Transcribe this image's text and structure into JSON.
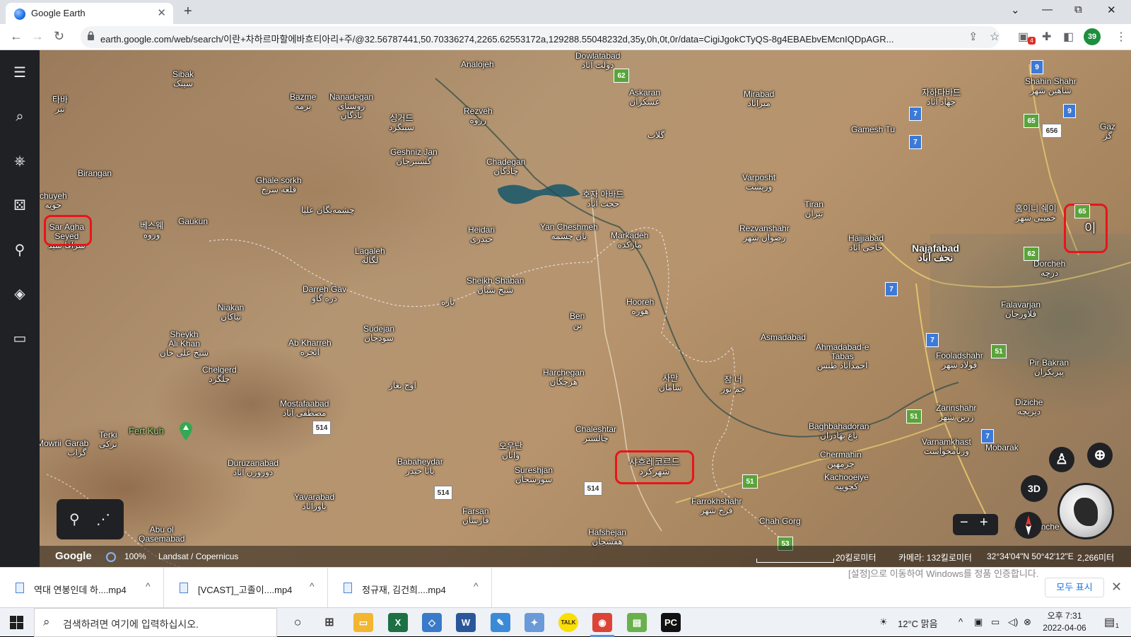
{
  "browser": {
    "tab_title": "Google Earth",
    "tab_close": "✕",
    "new_tab": "+",
    "url": "earth.google.com/web/search/이란+차하르마할에바흐티아리+주/@32.56787441,50.70336274,2265.62553172a,129288.55048232d,35y,0h,0t,0r/data=CigiJgokCTyQS-8g4EBAEbvEMcnIQDpAGR...",
    "profile_badge": "39",
    "extension_count": "4",
    "win_min": "⌄",
    "win_restore": "⧉",
    "win_close": "✕"
  },
  "map": {
    "places": [
      {
        "name": "Dowlatabad\nدولت آباد"
      },
      {
        "name": "Analojeh"
      },
      {
        "name": "Sibak\nسیبک"
      },
      {
        "name": "Bazme\nبزمه"
      },
      {
        "name": "Nanadegan\nروستای\nنادگان"
      },
      {
        "name": "싱거드\nسینگرد"
      },
      {
        "name": "Rezveh\nرزوه"
      },
      {
        "name": "Askaran\nعسکران"
      },
      {
        "name": "Mirabad\nمیرآباد"
      },
      {
        "name": "자하다바드\nجهاد آباد"
      },
      {
        "name": "Shahin Shahr\nشاهین شهر"
      },
      {
        "name": "타바\nتبر"
      },
      {
        "name": "Geshniz Jan\nگشنیزجان"
      },
      {
        "name": "Chadegan\nچادگان"
      },
      {
        "name": "گلاب"
      },
      {
        "name": "Gamesh Tu"
      },
      {
        "name": "Birangan"
      },
      {
        "name": "Ghale sorkh\nقلعه سرخ"
      },
      {
        "name": "Varposht\nورپشت"
      },
      {
        "name": "호자 아바드\nحجت آباد"
      },
      {
        "name": "chuyeh\nحویه"
      },
      {
        "name": "Gaukun"
      },
      {
        "name": "베스웨\nوروه"
      },
      {
        "name": "چشمه‌بگان علیا"
      },
      {
        "name": "Tiran\nتیران"
      },
      {
        "name": "Heidari\nحیدری"
      },
      {
        "name": "Yan Cheshmeh\nیان چشمه"
      },
      {
        "name": "Markadeh\nمارکده"
      },
      {
        "name": "Rezvanshahr\nرضوان شهر"
      },
      {
        "name": "Hajjiabad\nحاجی آباد"
      },
      {
        "name": "Najafabad\nنجف آباد"
      },
      {
        "name": "Lagaleh\nلگاله"
      },
      {
        "name": "Dorcheh\nدرچه"
      },
      {
        "name": "Sheikh Shaban\nشیخ شبان"
      },
      {
        "name": "Darreh Gav\nدره گاو"
      },
      {
        "name": "باره"
      },
      {
        "name": "Hooreh\nهوره"
      },
      {
        "name": "Niakan\nنیاکان"
      },
      {
        "name": "Ben\nبن"
      },
      {
        "name": "Falavarjan\nفلاورجان"
      },
      {
        "name": "Sudejan\nسودجان"
      },
      {
        "name": "Sheykh\nAli Khan\nشیخ علی خان"
      },
      {
        "name": "Ab Kharreh\nابخره"
      },
      {
        "name": "Asmadabad"
      },
      {
        "name": "Ahmadabad-e\nTabas\nاحمدآباد طبس"
      },
      {
        "name": "Fooladshahr\nفولاد شهر"
      },
      {
        "name": "Pir Bakran\nپیربکران"
      },
      {
        "name": "Chelgerd\nچلگرد"
      },
      {
        "name": "Harchegan\nهرچگان"
      },
      {
        "name": "사만\nسامان"
      },
      {
        "name": "잠 너\nجم نور"
      },
      {
        "name": "اوج بغار"
      },
      {
        "name": "Diziche\nدیزیچه"
      },
      {
        "name": "Zarinshahr\nزرین شهر"
      },
      {
        "name": "Mostafaabad\nمصطفی آباد"
      },
      {
        "name": "Fert Kuh"
      },
      {
        "name": "Terki\nترکی"
      },
      {
        "name": "Mowrii"
      },
      {
        "name": "Garab\nگراب"
      },
      {
        "name": "Chaleshtar\nچالشتر"
      },
      {
        "name": "Baghbahadoran\nباغ بهادران"
      },
      {
        "name": "Varnamkhast\nورنامخواست"
      },
      {
        "name": "Mobarak"
      },
      {
        "name": "오우난\nوانان"
      },
      {
        "name": "Chermahin\nچرمهین"
      },
      {
        "name": "Duruzanabad\nدوروزن آباد"
      },
      {
        "name": "Babaheydar\nبابا حیدر"
      },
      {
        "name": "Sureshjan\nسورشجان"
      },
      {
        "name": "Kachooeiye\nکچوییه"
      },
      {
        "name": "Yavarabad\nیاورآباد"
      },
      {
        "name": "Farrokhshahr\nفرخ شهر"
      },
      {
        "name": "Farsan\nفارسان"
      },
      {
        "name": "Chah Gorg"
      },
      {
        "name": "Abu ol\nQasemabad"
      },
      {
        "name": "Hafshejan\nهفشجان"
      },
      {
        "name": "Alkhoonche"
      },
      {
        "name": "Gaz\nگز"
      },
      {
        "name": "홈이니 쉐이\nخمینی شهر"
      }
    ],
    "highlighted_labels": {
      "left": "Sar Agha\nSeyed\nسرآقا سید",
      "center": "샤흐레코르드\nشهرکرد",
      "right": "이"
    },
    "road_shields": [
      "62",
      "9",
      "7",
      "7",
      "65",
      "656",
      "9",
      "65",
      "62",
      "7",
      "7",
      "51",
      "51",
      "7",
      "51",
      "514",
      "514",
      "514",
      "53"
    ],
    "controls": {
      "pin_icon": "⚲",
      "path_icon": "⋰",
      "btn_3d": "3D",
      "zoom_out": "−",
      "zoom_in": "+"
    },
    "status": {
      "brand": "Google",
      "load_percent": "100%",
      "imagery": "Landsat / Copernicus",
      "scale": "20킬로미터",
      "camera": "카메라: 132킬로미터",
      "coords": "32°34'04\"N 50°42'12\"E",
      "elevation": "2,266미터"
    }
  },
  "sidebar": {
    "menu_icon": "☰",
    "search_icon": "⌕",
    "voyager_icon": "⎈",
    "feeling_lucky_icon": "⚄",
    "projects_icon": "⚲",
    "map_style_icon": "◈",
    "measure_icon": "▭"
  },
  "downloads": {
    "items": [
      {
        "name": "역대 연봉인데 하....mp4"
      },
      {
        "name": "[VCAST]_고졸이....mp4"
      },
      {
        "name": "정규재, 김건희....mp4"
      }
    ],
    "chevron": "^",
    "show_all": "모두 표시",
    "close": "✕",
    "activation_notice": "[설정]으로 이동하여 Windows를 정품 인증합니다."
  },
  "taskbar": {
    "search_placeholder": "검색하려면 여기에 입력하십시오.",
    "weather": "12°C 맑음",
    "time": "오후 7:31",
    "date": "2022-04-06",
    "notif_count": "1",
    "apps": [
      {
        "label": "○",
        "color": "#1f1f1f"
      },
      {
        "label": "⊞",
        "color": "#444444"
      },
      {
        "label": "▭",
        "color": "#f2b632"
      },
      {
        "label": "X",
        "color": "#1d7044"
      },
      {
        "label": "◇",
        "color": "#3a7ac8"
      },
      {
        "label": "W",
        "color": "#2b579a"
      },
      {
        "label": "✎",
        "color": "#3a8ad8"
      },
      {
        "label": "✦",
        "color": "#6a9ad8"
      },
      {
        "label": "TALK",
        "color": "#f9e000"
      },
      {
        "label": "◉",
        "color": "#db4437"
      },
      {
        "label": "▤",
        "color": "#6ab04c"
      },
      {
        "label": "PC",
        "color": "#111111"
      }
    ]
  }
}
